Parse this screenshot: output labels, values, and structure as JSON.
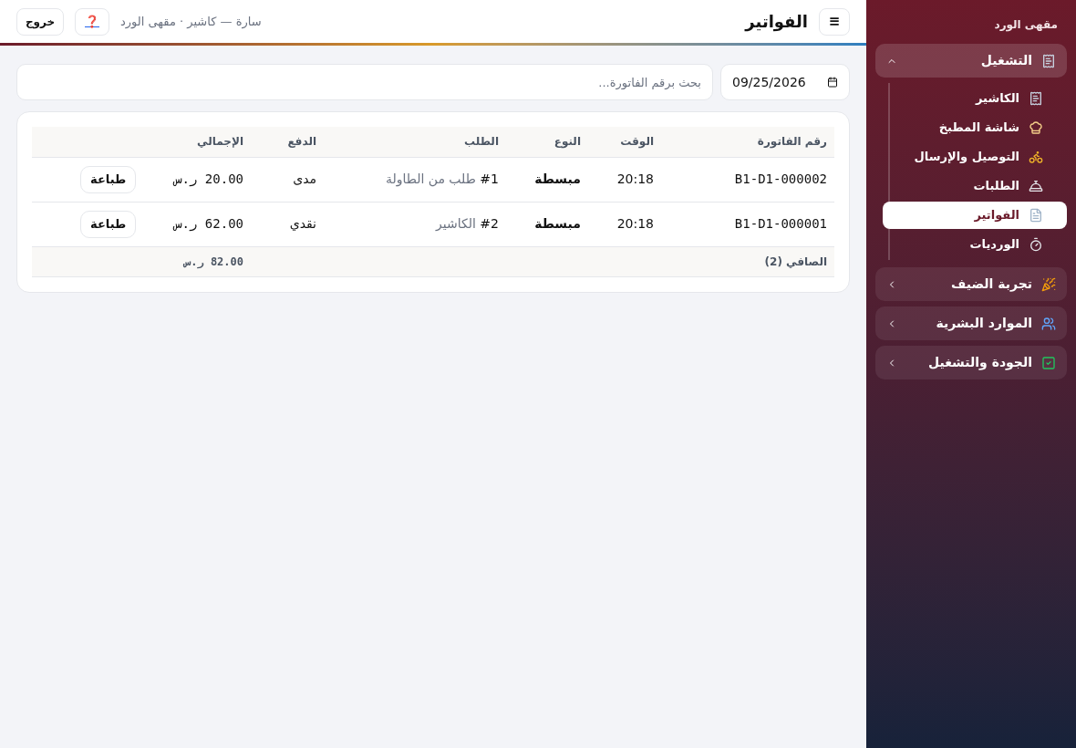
{
  "header": {
    "menu_glyph": "≡",
    "title": "الفواتير",
    "user_info": "سارة — كاشير · مقهى الورد",
    "help_glyph": "❓",
    "logout": "خروج"
  },
  "filters": {
    "date": "09/25/2026",
    "search_placeholder": "بحث برقم الفاتورة..."
  },
  "table": {
    "columns": [
      "رقم الفاتورة",
      "الوقت",
      "النوع",
      "الطلب",
      "الدفع",
      "الإجمالي"
    ],
    "rows": [
      {
        "invoice": "B1-D1-000002",
        "time": "20:18",
        "type": "مبسطة",
        "order_number": "#1",
        "order_source": "طلب من الطاولة",
        "payment": "مدى",
        "total": "20.00 ر.س",
        "action": "طباعة"
      },
      {
        "invoice": "B1-D1-000001",
        "time": "20:18",
        "type": "مبسطة",
        "order_number": "#2",
        "order_source": "الكاشير",
        "payment": "نقدي",
        "total": "62.00 ر.س",
        "action": "طباعة"
      }
    ],
    "footer": {
      "label": "الصافي (2)",
      "total": "82.00 ر.س"
    }
  },
  "sidebar": {
    "brand": "مقهى الورد",
    "groups": [
      {
        "label": "التشغيل",
        "kind": "receipt",
        "expanded": true,
        "items": [
          {
            "label": "الكاشير",
            "kind": "receipt",
            "selected": false
          },
          {
            "label": "شاشة المطبخ",
            "kind": "chef",
            "selected": false
          },
          {
            "label": "التوصيل والإرسال",
            "kind": "bike",
            "selected": false
          },
          {
            "label": "الطلبات",
            "kind": "bell",
            "selected": false
          },
          {
            "label": "الفواتير",
            "kind": "file",
            "selected": true
          },
          {
            "label": "الورديات",
            "kind": "timer",
            "selected": false
          }
        ]
      },
      {
        "label": "تجربة الضيف",
        "kind": "party",
        "expanded": false
      },
      {
        "label": "الموارد البشرية",
        "kind": "users",
        "expanded": false
      },
      {
        "label": "الجودة والتشغيل",
        "kind": "check",
        "expanded": false
      }
    ]
  }
}
